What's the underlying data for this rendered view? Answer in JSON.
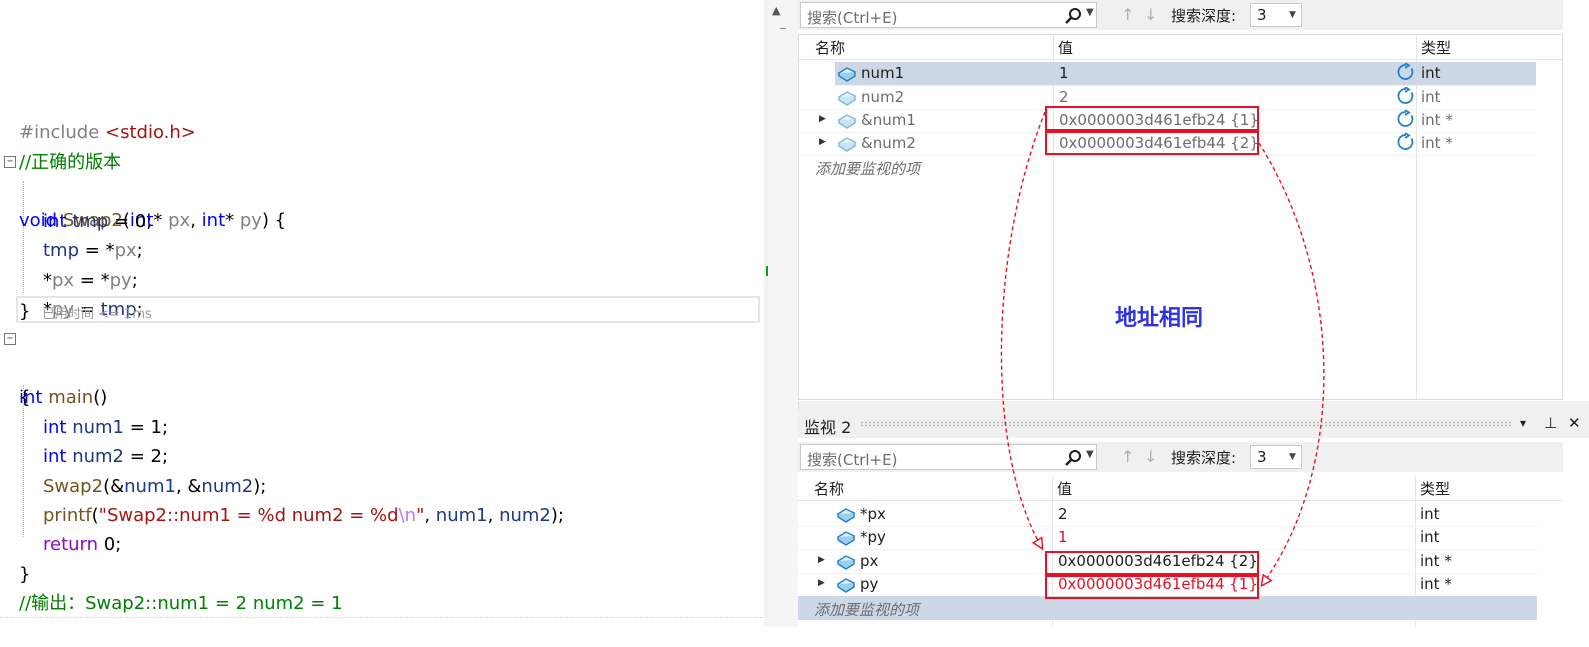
{
  "editor": {
    "include_keyword": "#include",
    "include_file": "<stdio.h>",
    "comment_version": "//正确的版本",
    "swap_signature": {
      "void": "void",
      "name": "Swap2",
      "open": "(",
      "int1": "int",
      "star1": "* ",
      "p1": "px",
      "comma": ", ",
      "int2": "int",
      "star2": "* ",
      "p2": "py",
      "close": ") {"
    },
    "swap_body": {
      "l1": {
        "kw": "int",
        "rest1": " ",
        "var": "tmp",
        "rest2": " = 0;"
      },
      "l2": {
        "var": "tmp",
        "rest": " = *",
        "p": "px",
        "end": ";"
      },
      "l3": {
        "star": "*",
        "p1": "px",
        "mid": " = *",
        "p2": "py",
        "end": ";"
      },
      "l4": {
        "star": "*",
        "p": "py",
        "mid": " = ",
        "var": "tmp",
        "end": ";"
      }
    },
    "close_brace": "}",
    "elapsed": "已用时间 <= 1ms",
    "main_signature": {
      "kw": "int",
      "name": "main",
      "rest": "()"
    },
    "open_brace": "{",
    "main_body": {
      "l1": {
        "kw": "int",
        "var": "num1",
        "rest": " = 1;"
      },
      "l2": {
        "kw": "int",
        "var": "num2",
        "rest": " = 2;"
      },
      "l3": {
        "fn": "Swap2",
        "a": "(&",
        "v1": "num1",
        "b": ", &",
        "v2": "num2",
        "c": ");"
      },
      "l4": {
        "fn": "printf",
        "open": "(",
        "str": "\"Swap2::num1 = %d num2 = %d",
        "esc": "\\n",
        "strend": "\"",
        "mid": ", ",
        "v1": "num1",
        "c": ", ",
        "v2": "num2",
        "end": ");"
      },
      "l5": {
        "kw": "return",
        "rest": " 0;"
      }
    },
    "end_brace": "}",
    "output_comment": "//输出：Swap2::num1 = 2 num2 = 1"
  },
  "watch1": {
    "search_placeholder": "搜索(Ctrl+E)",
    "depth_label": "搜索深度:",
    "depth_value": "3",
    "col_name": "名称",
    "col_value": "值",
    "col_type": "类型",
    "rows": [
      {
        "name": "num1",
        "value": "1",
        "type": "int",
        "expandable": false
      },
      {
        "name": "num2",
        "value": "2",
        "type": "int",
        "expandable": false
      },
      {
        "name": "&num1",
        "value": "0x0000003d461efb24 {1}",
        "type": "int *",
        "expandable": true
      },
      {
        "name": "&num2",
        "value": "0x0000003d461efb44 {2}",
        "type": "int *",
        "expandable": true
      }
    ],
    "add_item": "添加要监视的项"
  },
  "watch2": {
    "title": "监视 2",
    "search_placeholder": "搜索(Ctrl+E)",
    "depth_label": "搜索深度:",
    "depth_value": "3",
    "col_name": "名称",
    "col_value": "值",
    "col_type": "类型",
    "rows": [
      {
        "name": "*px",
        "value": "2",
        "type": "int",
        "expandable": false
      },
      {
        "name": "*py",
        "value": "1",
        "type": "int",
        "expandable": false
      },
      {
        "name": "px",
        "value": "0x0000003d461efb24 {2}",
        "type": "int *",
        "expandable": true
      },
      {
        "name": "py",
        "value": "0x0000003d461efb44 {1}",
        "type": "int *",
        "expandable": true
      }
    ],
    "add_item": "添加要监视的项",
    "buttons": {
      "dropdown": "▾",
      "pin": "⊥",
      "close": "✕"
    }
  },
  "annotation": "地址相同",
  "colors": {
    "highlight": "#e81123",
    "annotation": "#2d31e8",
    "keyword": "#0000ff",
    "comment": "#008000"
  }
}
